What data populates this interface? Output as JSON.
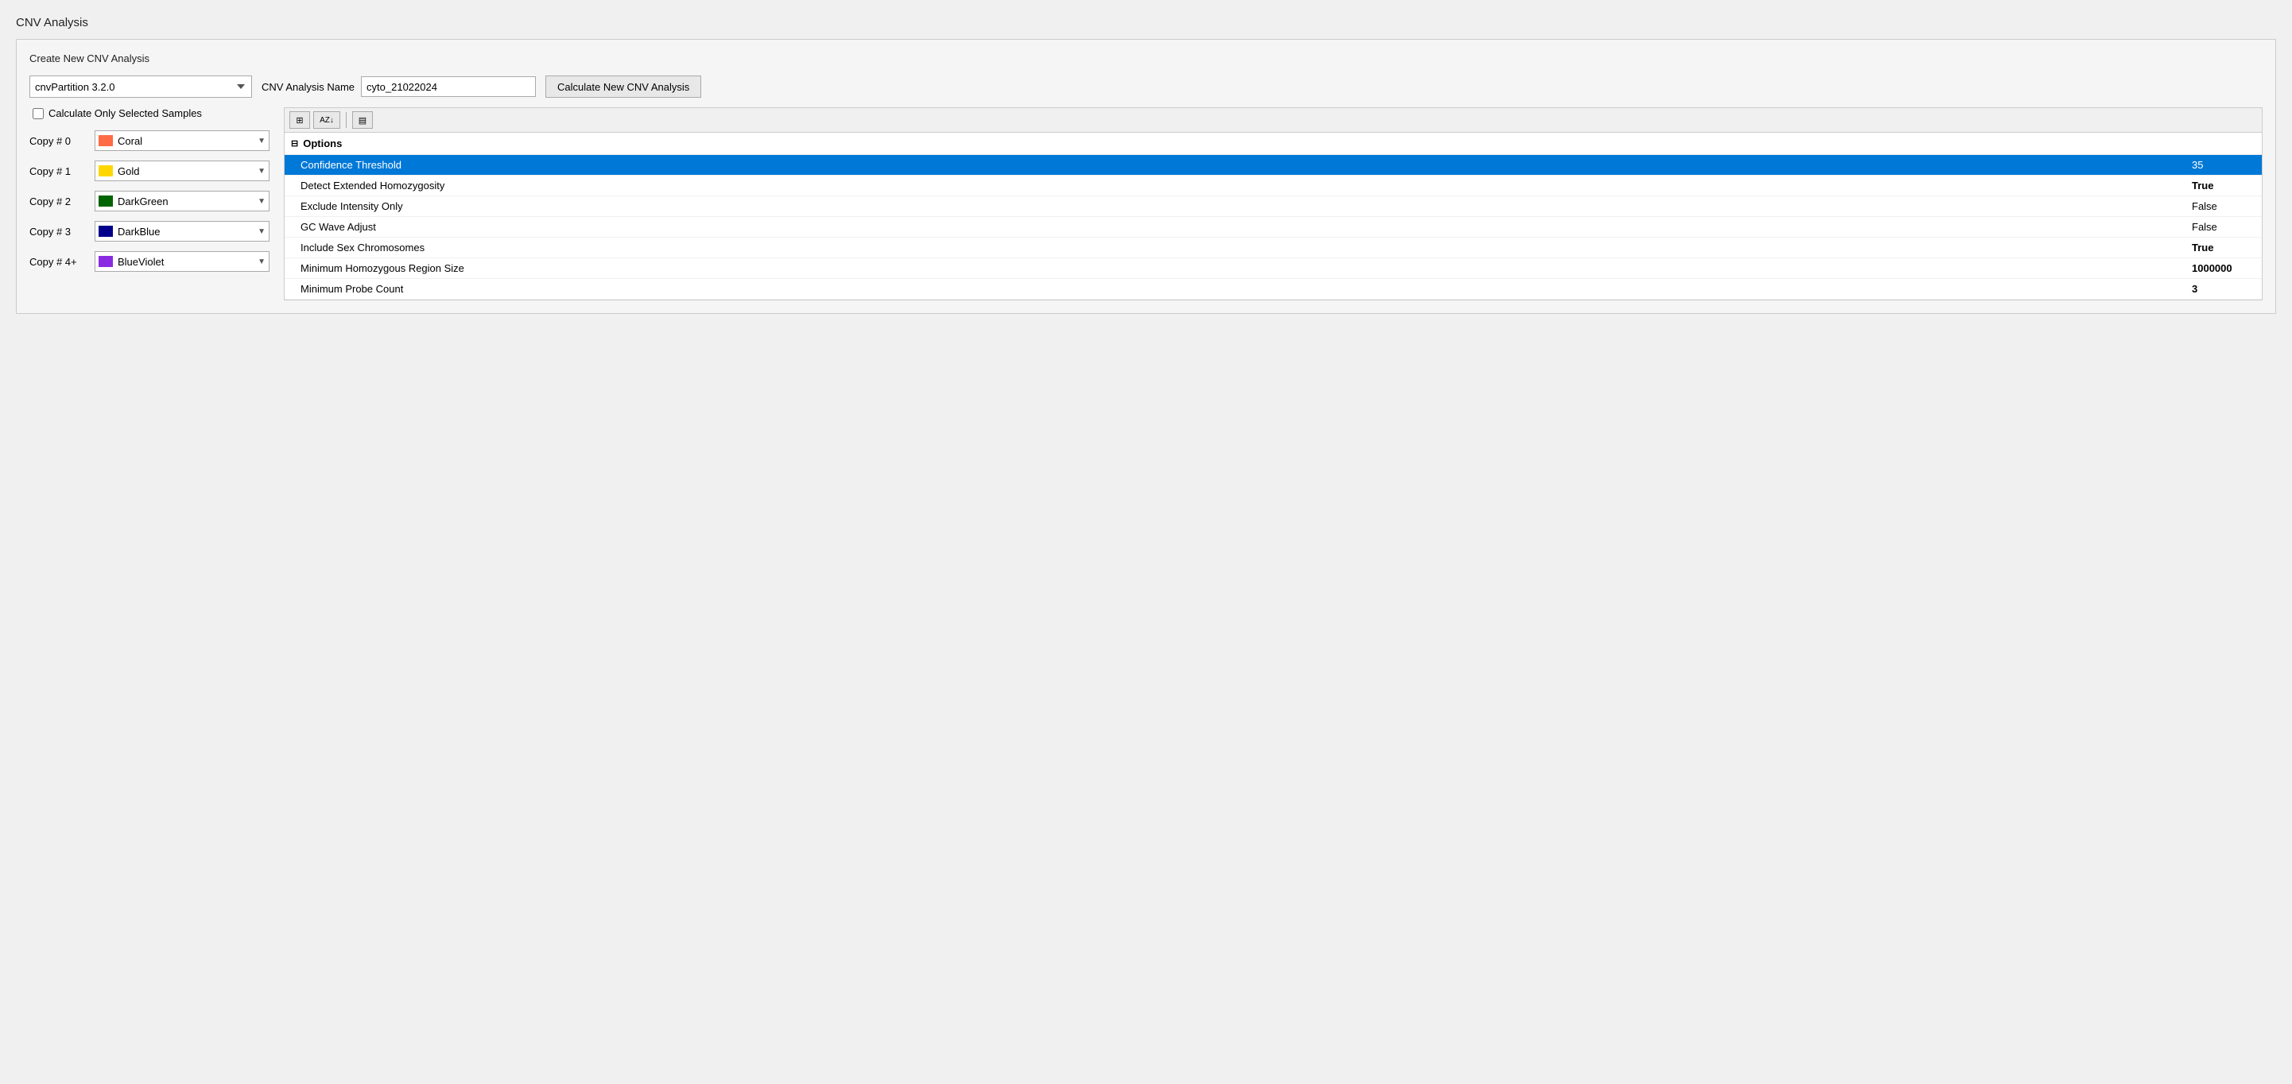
{
  "window": {
    "title": "CNV Analysis"
  },
  "panel": {
    "title": "Create New CNV Analysis"
  },
  "algorithm_select": {
    "value": "cnvPartition 3.2.0",
    "options": [
      "cnvPartition 3.2.0"
    ]
  },
  "cnv_name": {
    "label": "CNV Analysis Name",
    "value": "cyto_21022024",
    "placeholder": ""
  },
  "calculate_button": {
    "label": "Calculate New CNV Analysis"
  },
  "checkbox": {
    "label": "Calculate Only Selected Samples",
    "checked": false
  },
  "copies": [
    {
      "label": "Copy # 0",
      "color_name": "Coral",
      "color_hex": "#FF6B45"
    },
    {
      "label": "Copy # 1",
      "color_name": "Gold",
      "color_hex": "#FFD700"
    },
    {
      "label": "Copy # 2",
      "color_name": "DarkGreen",
      "color_hex": "#006400"
    },
    {
      "label": "Copy # 3",
      "color_name": "DarkBlue",
      "color_hex": "#00008B"
    },
    {
      "label": "Copy # 4+",
      "color_name": "BlueViolet",
      "color_hex": "#8A2BE2"
    }
  ],
  "toolbar": {
    "btn1": "⊞",
    "btn2": "AZ↓",
    "btn3": "▤"
  },
  "options_section": {
    "header": "Options",
    "items": [
      {
        "name": "Confidence Threshold",
        "value": "35",
        "selected": true,
        "bold_value": false
      },
      {
        "name": "Detect Extended Homozygosity",
        "value": "True",
        "selected": false,
        "bold_value": true
      },
      {
        "name": "Exclude Intensity Only",
        "value": "False",
        "selected": false,
        "bold_value": false
      },
      {
        "name": "GC Wave Adjust",
        "value": "False",
        "selected": false,
        "bold_value": false
      },
      {
        "name": "Include Sex Chromosomes",
        "value": "True",
        "selected": false,
        "bold_value": true
      },
      {
        "name": "Minimum Homozygous Region Size",
        "value": "1000000",
        "selected": false,
        "bold_value": true
      },
      {
        "name": "Minimum Probe Count",
        "value": "3",
        "selected": false,
        "bold_value": true
      }
    ]
  }
}
